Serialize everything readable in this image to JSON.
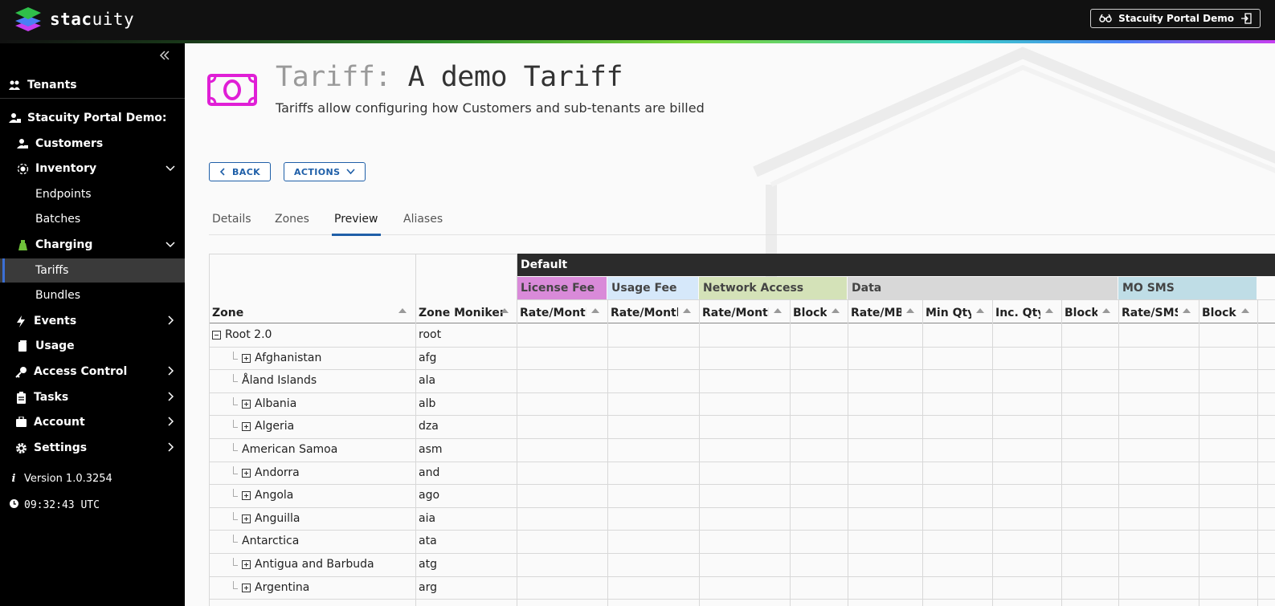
{
  "app": {
    "brand_prefix": "stac",
    "brand_suffix": "uity",
    "account_button": "Stacuity Portal Demo"
  },
  "sidebar": {
    "items": [
      {
        "label": "Tenants",
        "icon": "tenants-icon"
      },
      {
        "label": "Stacuity Portal Demo:",
        "icon": "tenant-user-icon"
      },
      {
        "label": "Customers",
        "icon": "customers-icon"
      },
      {
        "label": "Inventory",
        "icon": "inventory-icon"
      },
      {
        "label": "Endpoints"
      },
      {
        "label": "Batches"
      },
      {
        "label": "Charging",
        "icon": "charging-icon"
      },
      {
        "label": "Tariffs"
      },
      {
        "label": "Bundles"
      },
      {
        "label": "Events",
        "icon": "lightning-icon"
      },
      {
        "label": "Usage",
        "icon": "usage-icon"
      },
      {
        "label": "Access Control",
        "icon": "key-icon"
      },
      {
        "label": "Tasks",
        "icon": "clipboard-icon"
      },
      {
        "label": "Account",
        "icon": "account-icon"
      },
      {
        "label": "Settings",
        "icon": "gear-icon"
      }
    ],
    "version": "Version 1.0.3254",
    "clock": "09:32:43 UTC"
  },
  "page": {
    "title_prefix": "Tariff:",
    "title_name": "A demo Tariff",
    "subtitle": "Tariffs allow configuring how Customers and sub-tenants are billed",
    "back_button": "BACK",
    "actions_button": "ACTIONS",
    "tabs": [
      "Details",
      "Zones",
      "Preview",
      "Aliases"
    ],
    "active_tab": "Preview"
  },
  "table": {
    "group_header": "Default",
    "zone_header": "Zone",
    "moniker_header": "Zone Moniker",
    "sections": [
      {
        "label": "License Fee",
        "color": "#d98ad9"
      },
      {
        "label": "Usage Fee",
        "color": "#d6e8fa"
      },
      {
        "label": "Network Access",
        "color": "#d4e2b8"
      },
      {
        "label": "Data",
        "color": "#d8d8d8"
      },
      {
        "label": "MO SMS",
        "color": "#bfdde6"
      }
    ],
    "columns": [
      "Rate/Month",
      "Rate/Month",
      "Rate/Month",
      "Block",
      "Rate/MB",
      "Min Qty",
      "Inc. Qty",
      "Block",
      "Rate/SMS",
      "Block"
    ],
    "rows": [
      {
        "zone": "Root 2.0",
        "moniker": "root",
        "expand": "minus",
        "level": 0
      },
      {
        "zone": "Afghanistan",
        "moniker": "afg",
        "expand": "plus",
        "level": 1
      },
      {
        "zone": "Åland Islands",
        "moniker": "ala",
        "expand": "none",
        "level": 1
      },
      {
        "zone": "Albania",
        "moniker": "alb",
        "expand": "plus",
        "level": 1
      },
      {
        "zone": "Algeria",
        "moniker": "dza",
        "expand": "plus",
        "level": 1
      },
      {
        "zone": "American Samoa",
        "moniker": "asm",
        "expand": "none",
        "level": 1
      },
      {
        "zone": "Andorra",
        "moniker": "and",
        "expand": "plus",
        "level": 1
      },
      {
        "zone": "Angola",
        "moniker": "ago",
        "expand": "plus",
        "level": 1
      },
      {
        "zone": "Anguilla",
        "moniker": "aia",
        "expand": "plus",
        "level": 1
      },
      {
        "zone": "Antarctica",
        "moniker": "ata",
        "expand": "none",
        "level": 1
      },
      {
        "zone": "Antigua and Barbuda",
        "moniker": "atg",
        "expand": "plus",
        "level": 1
      },
      {
        "zone": "Argentina",
        "moniker": "arg",
        "expand": "plus",
        "level": 1
      }
    ]
  },
  "colors": {
    "accent": "#1f5fa8",
    "tariff_icon": "#e01fd6",
    "active_nav": "#3b6fd4",
    "group_header_bg": "#2b2b2b"
  }
}
